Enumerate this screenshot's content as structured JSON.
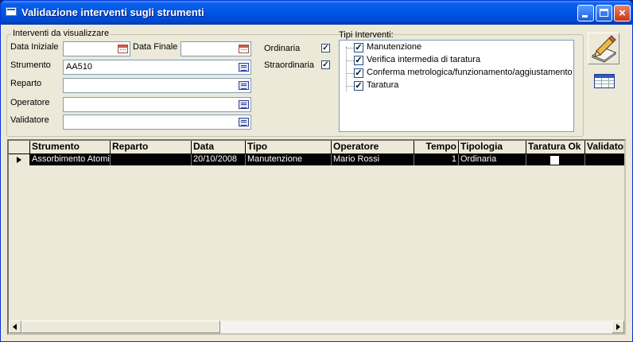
{
  "window": {
    "title": "Validazione interventi sugli strumenti",
    "min_glyph": "",
    "close_glyph": "×"
  },
  "filter": {
    "legend": "Interventi da visualizzare",
    "data_iniziale_label": "Data Iniziale",
    "data_iniziale_value": "",
    "data_finale_label": "Data Finale",
    "data_finale_value": "",
    "strumento_label": "Strumento",
    "strumento_value": "AA510",
    "reparto_label": "Reparto",
    "reparto_value": "",
    "operatore_label": "Operatore",
    "operatore_value": "",
    "validatore_label": "Validatore",
    "validatore_value": "",
    "ordinaria_label": "Ordinaria",
    "ordinaria_checked": "✓",
    "straordinaria_label": "Straordinaria",
    "straordinaria_checked": "✓"
  },
  "tipi": {
    "label": "Tipi Interventi:",
    "items": [
      {
        "label": "Manutenzione",
        "check": "✓"
      },
      {
        "label": "Verifica intermedia di taratura",
        "check": "✓"
      },
      {
        "label": "Conferma metrologica/funzionamento/aggiustamento",
        "check": "✓"
      },
      {
        "label": "Taratura",
        "check": "✓"
      }
    ]
  },
  "grid": {
    "columns": [
      "Strumento",
      "Reparto",
      "Data",
      "Tipo",
      "Operatore",
      "Tempo",
      "Tipologia",
      "Taratura Ok",
      "Validatore"
    ],
    "rows": [
      {
        "strumento": "Assorbimento Atomic",
        "reparto": "",
        "data": "20/10/2008",
        "tipo": "Manutenzione",
        "operatore": "Mario Rossi",
        "tempo": "1",
        "tipologia": "Ordinaria",
        "taratura_ok": "",
        "validatore": ""
      }
    ]
  },
  "icons": {
    "window": "app-window-icon",
    "calendar": "calendar-icon",
    "list": "list-icon",
    "edit": "pencil-edit-icon",
    "table": "table-icon"
  },
  "colors": {
    "title_bar": "#0055e5",
    "selected_row": "#000000",
    "window_bg": "#ece9d8"
  }
}
